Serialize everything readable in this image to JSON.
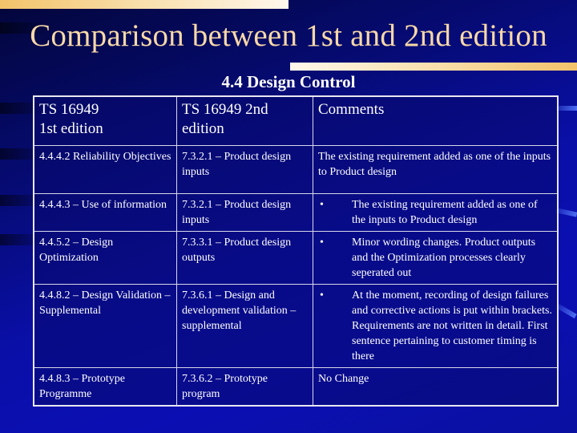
{
  "slide": {
    "title": "Comparison between 1st and 2nd edition",
    "subtitle": "4.4 Design Control",
    "colors": {
      "background": "#0a0fa8",
      "title_text": "#f8d8a8",
      "accent_gold": "#f3c36a",
      "table_border": "#e8e8f0",
      "text": "#ffffff"
    }
  },
  "table": {
    "headers": [
      "TS 16949\n1st edition",
      "TS 16949  2nd edition",
      "Comments"
    ],
    "header_lines": {
      "h1": [
        "TS 16949",
        "1st edition"
      ],
      "h2": [
        "TS 16949  2nd",
        "edition"
      ],
      "h3": [
        "Comments"
      ]
    },
    "rows": [
      {
        "first": "4.4.4.2 Reliability Objectives",
        "second": "7.3.2.1 – Product design inputs",
        "comment": "The existing requirement added as one of the inputs to Product design",
        "bullet": false
      },
      {
        "first": "4.4.4.3 – Use of information",
        "second": "7.3.2.1 – Product design inputs",
        "comment": "The existing requirement added as one of the inputs to Product design",
        "bullet": true
      },
      {
        "first": "4.4.5.2 – Design Optimization",
        "second": "7.3.3.1 – Product design outputs",
        "comment": "Minor wording changes. Product outputs and the Optimization processes clearly seperated out",
        "bullet": true
      },
      {
        "first": "4.4.8.2 – Design Validation – Supplemental",
        "second": "7.3.6.1 – Design and development validation – supplemental",
        "comment": "At the moment, recording of design failures and corrective actions is put within brackets. Requirements are not written in detail. First sentence pertaining to customer timing is there",
        "bullet": true
      },
      {
        "first": "4.4.8.3 – Prototype Programme",
        "second": "7.3.6.2 – Prototype program",
        "comment": "No Change",
        "bullet": false
      }
    ],
    "bullet_glyph": "•"
  }
}
